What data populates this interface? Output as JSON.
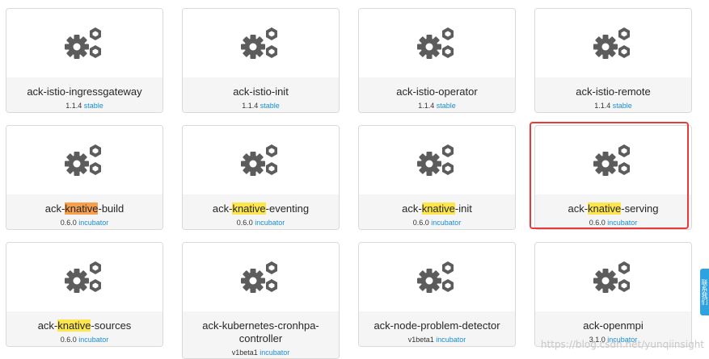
{
  "charts": [
    {
      "name": "ack-istio-ingressgateway",
      "version": "1.1.4",
      "label": "stable"
    },
    {
      "name": "ack-istio-init",
      "version": "1.1.4",
      "label": "stable"
    },
    {
      "name": "ack-istio-operator",
      "version": "1.1.4",
      "label": "stable"
    },
    {
      "name": "ack-istio-remote",
      "version": "1.1.4",
      "label": "stable"
    },
    {
      "name_pre": "ack-",
      "name_hl": "knative",
      "name_post": "-build",
      "version": "0.6.0",
      "label": "incubator"
    },
    {
      "name_pre": "ack-",
      "name_hl": "knative",
      "name_post": "-eventing",
      "version": "0.6.0",
      "label": "incubator"
    },
    {
      "name_pre": "ack-",
      "name_hl": "knative",
      "name_post": "-init",
      "version": "0.6.0",
      "label": "incubator"
    },
    {
      "name_pre": "ack-",
      "name_hl": "knative",
      "name_post": "-serving",
      "version": "0.6.0",
      "label": "incubator"
    },
    {
      "name_pre": "ack-",
      "name_hl": "knative",
      "name_post": "-sources",
      "version": "0.6.0",
      "label": "incubator"
    },
    {
      "name": "ack-kubernetes-cronhpa-controller",
      "version": "v1beta1",
      "label": "incubator"
    },
    {
      "name": "ack-node-problem-detector",
      "version": "v1beta1",
      "label": "incubator"
    },
    {
      "name": "ack-openmpi",
      "version": "3.1.0",
      "label": "incubator"
    }
  ],
  "side_tab": "联系我们",
  "watermark": "https://blog.csdn.net/yunqiinsight",
  "colors": {
    "highlight": "#fde64b",
    "highlight_orange": "#f6a04d",
    "selection": "#e83a3a",
    "label": "#1a8fd0",
    "icon": "#5c5c5c"
  },
  "icon": "gears-icon"
}
